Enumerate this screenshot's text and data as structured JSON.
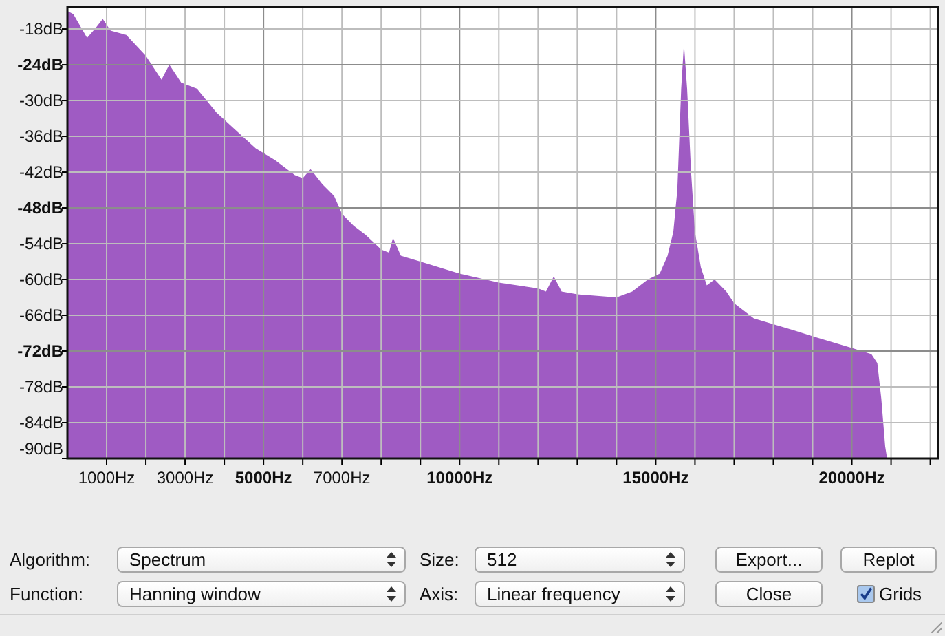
{
  "spectrum": {
    "chart_data": {
      "type": "area",
      "xlim": [
        0,
        22200
      ],
      "ylim": [
        -90,
        -14.3
      ],
      "xticks": [
        {
          "value": 1000,
          "label": "1000Hz"
        },
        {
          "value": 3000,
          "label": "3000Hz"
        },
        {
          "value": 5000,
          "label": "5000Hz"
        },
        {
          "value": 7000,
          "label": "7000Hz"
        },
        {
          "value": 10000,
          "label": "10000Hz"
        },
        {
          "value": 15000,
          "label": "15000Hz"
        },
        {
          "value": 20000,
          "label": "20000Hz"
        }
      ],
      "yticks": [
        {
          "value": -18,
          "label": "-18dB"
        },
        {
          "value": -24,
          "label": "-24dB"
        },
        {
          "value": -30,
          "label": "-30dB"
        },
        {
          "value": -36,
          "label": "-36dB"
        },
        {
          "value": -42,
          "label": "-42dB"
        },
        {
          "value": -48,
          "label": "-48dB"
        },
        {
          "value": -54,
          "label": "-54dB"
        },
        {
          "value": -60,
          "label": "-60dB"
        },
        {
          "value": -66,
          "label": "-66dB"
        },
        {
          "value": -72,
          "label": "-72dB"
        },
        {
          "value": -78,
          "label": "-78dB"
        },
        {
          "value": -84,
          "label": "-84dB"
        },
        {
          "value": -90,
          "label": "-90dB"
        }
      ],
      "grid": true,
      "x": [
        0,
        0,
        150,
        500,
        700,
        900,
        1100,
        1500,
        2000,
        2200,
        2400,
        2600,
        2900,
        3300,
        3800,
        4300,
        4800,
        5300,
        5800,
        6000,
        6200,
        6500,
        6800,
        7000,
        7300,
        7600,
        8000,
        8200,
        8300,
        8500,
        9000,
        10000,
        11000,
        12000,
        12200,
        12400,
        12600,
        13000,
        14000,
        14400,
        14800,
        15100,
        15300,
        15450,
        15550,
        15650,
        15720,
        15800,
        15900,
        16000,
        16150,
        16300,
        16500,
        16800,
        17000,
        17500,
        18000,
        18500,
        19000,
        19500,
        20000,
        20500,
        20650,
        20750,
        20850,
        20900
      ],
      "series": [
        {
          "color": "#9f5bc3",
          "values": [
            -90,
            -15,
            -15.5,
            -19.5,
            -18,
            -16.3,
            -18.3,
            -19,
            -22.5,
            -24.5,
            -26.5,
            -24,
            -27,
            -28,
            -32,
            -35,
            -38,
            -40,
            -42.5,
            -43,
            -41.5,
            -44,
            -46,
            -49,
            -51,
            -52.5,
            -55,
            -55.5,
            -53,
            -56,
            -57,
            -59,
            -60.5,
            -61.5,
            -62,
            -59.5,
            -62,
            -62.5,
            -63,
            -62,
            -60,
            -59,
            -56,
            -52,
            -45,
            -28,
            -20.5,
            -28,
            -42,
            -52,
            -58,
            -61,
            -60,
            -62,
            -64,
            -66.5,
            -67.5,
            -68.5,
            -69.5,
            -70.5,
            -71.5,
            -72.5,
            -74,
            -80,
            -88,
            -90
          ]
        }
      ]
    }
  },
  "fields": [
    {
      "label": "Algorithm:",
      "value": "Spectrum"
    },
    {
      "label": "Size:",
      "value": "512"
    },
    {
      "label": "Function:",
      "value": "Hanning window"
    },
    {
      "label": "Axis:",
      "value": "Linear frequency"
    }
  ],
  "buttons": [
    "Export...",
    "Replot",
    "Close"
  ],
  "grids": {
    "label": "Grids",
    "checked": true
  }
}
